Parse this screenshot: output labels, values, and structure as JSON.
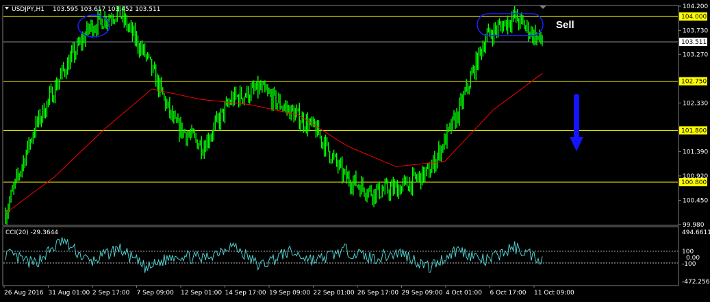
{
  "header": {
    "symbol": "USDJPY,H1",
    "ohlc": "103.595 103.617 103.452 103.511"
  },
  "indicator": {
    "label": "CCI(20) -29.3644",
    "scale_top": "494.6611",
    "scale_bottom": "-472.2561",
    "levels": [
      "100",
      "0.00",
      "-100"
    ]
  },
  "annotation": {
    "sell_label": "Sell"
  },
  "colors": {
    "background": "#000000",
    "price": "#00ff00",
    "moving_average": "#ff0000",
    "levels": "#ffff00",
    "current_price_line": "#9aa3b5",
    "cci": "#4fd0d0",
    "ellipse": "#1e1eff",
    "arrow": "#1414ff"
  },
  "chart_data": [
    {
      "type": "line",
      "title": "USDJPY,H1",
      "x": [
        "26 Aug 2016",
        "31 Aug 01:00",
        "2 Sep 17:00",
        "7 Sep 09:00",
        "12 Sep 01:00",
        "14 Sep 17:00",
        "19 Sep 09:00",
        "22 Sep 01:00",
        "26 Sep 17:00",
        "29 Sep 09:00",
        "4 Oct 01:00",
        "6 Oct 17:00",
        "11 Oct 09:00"
      ],
      "y_ticks": [
        "104.200",
        "103.730",
        "103.270",
        "102.330",
        "101.390",
        "100.920",
        "100.450",
        "99.980"
      ],
      "ylim": [
        99.98,
        104.2
      ],
      "series": [
        {
          "values": [
            100.2,
            101.8,
            102.9,
            103.8,
            104.1,
            103.2,
            101.9,
            101.5,
            102.4,
            102.6,
            102.2,
            101.8,
            100.9,
            100.6,
            100.7,
            101.0,
            102.1,
            103.6,
            104.0,
            103.5
          ]
        },
        {
          "values": [
            100.2,
            100.9,
            101.8,
            102.6,
            102.4,
            102.3,
            102.1,
            101.5,
            101.1,
            101.2,
            102.2,
            102.9
          ]
        }
      ],
      "horizontal_levels": [
        {
          "value": 104.0,
          "label": "104.000"
        },
        {
          "value": 102.75,
          "label": "102.750"
        },
        {
          "value": 101.8,
          "label": "101.800"
        },
        {
          "value": 100.8,
          "label": "100.800"
        }
      ],
      "current_price": {
        "value": 103.511,
        "label": "103.511"
      }
    },
    {
      "type": "line",
      "title": "CCI(20) -29.3644",
      "ylim": [
        -472.2561,
        494.6611
      ],
      "levels": [
        100,
        0,
        -100
      ],
      "series": [
        {
          "values": [
            60,
            -120,
            280,
            -90,
            150,
            -200,
            40,
            -30,
            210,
            -150,
            90,
            -60,
            120,
            -20,
            80,
            -180,
            130,
            -70,
            170,
            -40
          ]
        }
      ]
    }
  ]
}
